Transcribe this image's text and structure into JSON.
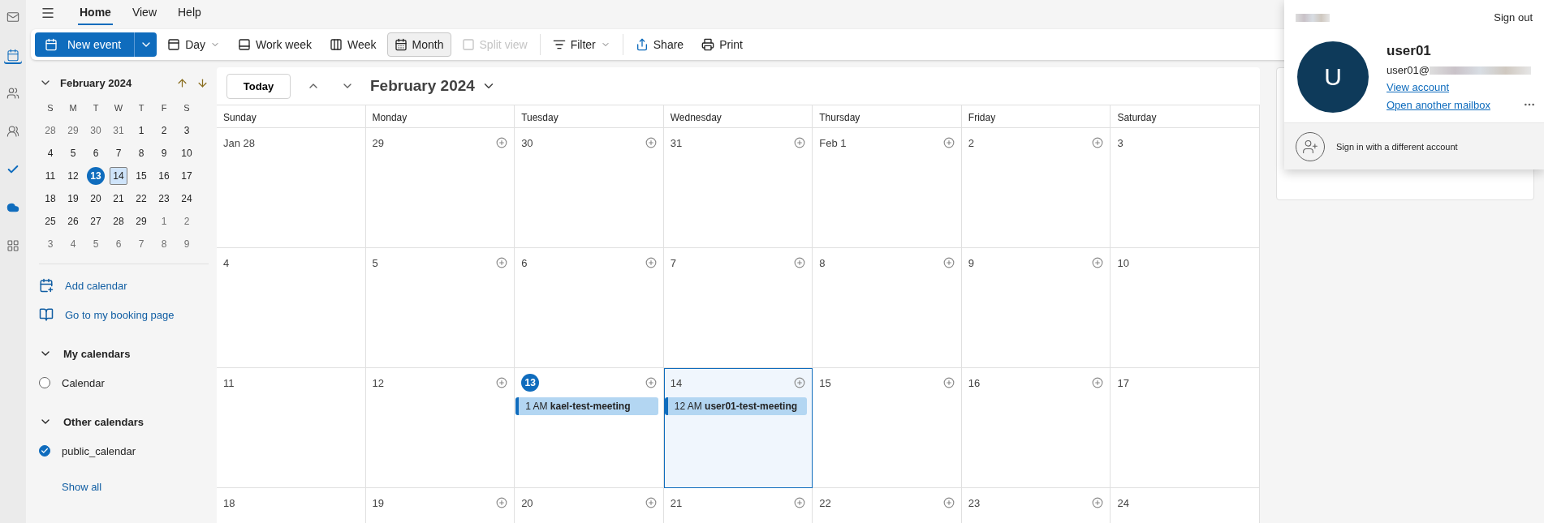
{
  "nav_rail": [
    {
      "kind": "mail",
      "selected": false
    },
    {
      "kind": "calendar",
      "selected": true
    },
    {
      "kind": "people",
      "selected": false
    },
    {
      "kind": "groups",
      "selected": false
    },
    {
      "kind": "todo",
      "selected": false
    },
    {
      "kind": "cloud",
      "selected": false
    },
    {
      "kind": "apps",
      "selected": false
    }
  ],
  "menu_tabs": [
    {
      "label": "Home",
      "selected": true
    },
    {
      "label": "View",
      "selected": false
    },
    {
      "label": "Help",
      "selected": false
    }
  ],
  "ribbon": {
    "new_event": "New event",
    "buttons": [
      {
        "kind": "day",
        "label": "Day",
        "dropdown": true,
        "selected": false,
        "disabled": false
      },
      {
        "kind": "workweek",
        "label": "Work week",
        "dropdown": false,
        "selected": false,
        "disabled": false
      },
      {
        "kind": "week",
        "label": "Week",
        "dropdown": false,
        "selected": false,
        "disabled": false
      },
      {
        "kind": "month",
        "label": "Month",
        "dropdown": false,
        "selected": true,
        "disabled": false
      },
      {
        "kind": "split",
        "label": "Split view",
        "dropdown": false,
        "selected": false,
        "disabled": true
      },
      {
        "kind": "filter",
        "label": "Filter",
        "dropdown": true,
        "selected": false,
        "disabled": false
      },
      {
        "kind": "share",
        "label": "Share",
        "dropdown": false,
        "selected": false,
        "disabled": false
      },
      {
        "kind": "print",
        "label": "Print",
        "dropdown": false,
        "selected": false,
        "disabled": false
      }
    ]
  },
  "mini_calendar": {
    "title": "February 2024",
    "weekdays": [
      "S",
      "M",
      "T",
      "W",
      "T",
      "F",
      "S"
    ],
    "weeks": [
      [
        {
          "day": "28",
          "muted": true,
          "today": false,
          "selected": false
        },
        {
          "day": "29",
          "muted": true,
          "today": false,
          "selected": false
        },
        {
          "day": "30",
          "muted": true,
          "today": false,
          "selected": false
        },
        {
          "day": "31",
          "muted": true,
          "today": false,
          "selected": false
        },
        {
          "day": "1",
          "muted": false,
          "today": false,
          "selected": false
        },
        {
          "day": "2",
          "muted": false,
          "today": false,
          "selected": false
        },
        {
          "day": "3",
          "muted": false,
          "today": false,
          "selected": false
        }
      ],
      [
        {
          "day": "4",
          "muted": false,
          "today": false,
          "selected": false
        },
        {
          "day": "5",
          "muted": false,
          "today": false,
          "selected": false
        },
        {
          "day": "6",
          "muted": false,
          "today": false,
          "selected": false
        },
        {
          "day": "7",
          "muted": false,
          "today": false,
          "selected": false
        },
        {
          "day": "8",
          "muted": false,
          "today": false,
          "selected": false
        },
        {
          "day": "9",
          "muted": false,
          "today": false,
          "selected": false
        },
        {
          "day": "10",
          "muted": false,
          "today": false,
          "selected": false
        }
      ],
      [
        {
          "day": "11",
          "muted": false,
          "today": false,
          "selected": false
        },
        {
          "day": "12",
          "muted": false,
          "today": false,
          "selected": false
        },
        {
          "day": "13",
          "muted": false,
          "today": true,
          "selected": false
        },
        {
          "day": "14",
          "muted": false,
          "today": false,
          "selected": true
        },
        {
          "day": "15",
          "muted": false,
          "today": false,
          "selected": false
        },
        {
          "day": "16",
          "muted": false,
          "today": false,
          "selected": false
        },
        {
          "day": "17",
          "muted": false,
          "today": false,
          "selected": false
        }
      ],
      [
        {
          "day": "18",
          "muted": false,
          "today": false,
          "selected": false
        },
        {
          "day": "19",
          "muted": false,
          "today": false,
          "selected": false
        },
        {
          "day": "20",
          "muted": false,
          "today": false,
          "selected": false
        },
        {
          "day": "21",
          "muted": false,
          "today": false,
          "selected": false
        },
        {
          "day": "22",
          "muted": false,
          "today": false,
          "selected": false
        },
        {
          "day": "23",
          "muted": false,
          "today": false,
          "selected": false
        },
        {
          "day": "24",
          "muted": false,
          "today": false,
          "selected": false
        }
      ],
      [
        {
          "day": "25",
          "muted": false,
          "today": false,
          "selected": false
        },
        {
          "day": "26",
          "muted": false,
          "today": false,
          "selected": false
        },
        {
          "day": "27",
          "muted": false,
          "today": false,
          "selected": false
        },
        {
          "day": "28",
          "muted": false,
          "today": false,
          "selected": false
        },
        {
          "day": "29",
          "muted": false,
          "today": false,
          "selected": false
        },
        {
          "day": "1",
          "muted": true,
          "today": false,
          "selected": false
        },
        {
          "day": "2",
          "muted": true,
          "today": false,
          "selected": false
        }
      ],
      [
        {
          "day": "3",
          "muted": true,
          "today": false,
          "selected": false
        },
        {
          "day": "4",
          "muted": true,
          "today": false,
          "selected": false
        },
        {
          "day": "5",
          "muted": true,
          "today": false,
          "selected": false
        },
        {
          "day": "6",
          "muted": true,
          "today": false,
          "selected": false
        },
        {
          "day": "7",
          "muted": true,
          "today": false,
          "selected": false
        },
        {
          "day": "8",
          "muted": true,
          "today": false,
          "selected": false
        },
        {
          "day": "9",
          "muted": true,
          "today": false,
          "selected": false
        }
      ]
    ]
  },
  "sidebar_links": [
    {
      "kind": "add",
      "label": "Add calendar"
    },
    {
      "kind": "booking",
      "label": "Go to my booking page"
    }
  ],
  "calendar_groups": [
    {
      "title": "My calendars",
      "expanded": true,
      "items": [
        {
          "label": "Calendar",
          "checked": false
        }
      ]
    },
    {
      "title": "Other calendars",
      "expanded": true,
      "items": [
        {
          "label": "public_calendar",
          "checked": true
        }
      ]
    }
  ],
  "show_all": "Show all",
  "calendar": {
    "today_button": "Today",
    "title": "February 2024",
    "weekdays": [
      "Sunday",
      "Monday",
      "Tuesday",
      "Wednesday",
      "Thursday",
      "Friday",
      "Saturday"
    ],
    "weeks": [
      [
        {
          "label": "Jan 28",
          "today": false,
          "selected": false
        },
        {
          "label": "29",
          "today": false,
          "selected": false
        },
        {
          "label": "30",
          "today": false,
          "selected": false
        },
        {
          "label": "31",
          "today": false,
          "selected": false
        },
        {
          "label": "Feb 1",
          "today": false,
          "selected": false
        },
        {
          "label": "2",
          "today": false,
          "selected": false
        },
        {
          "label": "3",
          "today": false,
          "selected": false
        }
      ],
      [
        {
          "label": "4",
          "today": false,
          "selected": false
        },
        {
          "label": "5",
          "today": false,
          "selected": false
        },
        {
          "label": "6",
          "today": false,
          "selected": false
        },
        {
          "label": "7",
          "today": false,
          "selected": false
        },
        {
          "label": "8",
          "today": false,
          "selected": false
        },
        {
          "label": "9",
          "today": false,
          "selected": false
        },
        {
          "label": "10",
          "today": false,
          "selected": false
        }
      ],
      [
        {
          "label": "11",
          "today": false,
          "selected": false
        },
        {
          "label": "12",
          "today": false,
          "selected": false
        },
        {
          "label": "13",
          "today": true,
          "selected": false,
          "events": [
            "1 AM **kael-test-meeting**"
          ]
        },
        {
          "label": "14",
          "today": false,
          "selected": true,
          "events": [
            "12 AM **user01-test-meeting**"
          ]
        },
        {
          "label": "15",
          "today": false,
          "selected": false
        },
        {
          "label": "16",
          "today": false,
          "selected": false
        },
        {
          "label": "17",
          "today": false,
          "selected": false
        }
      ],
      [
        {
          "label": "18",
          "today": false,
          "selected": false
        },
        {
          "label": "19",
          "today": false,
          "selected": false
        },
        {
          "label": "20",
          "today": false,
          "selected": false
        },
        {
          "label": "21",
          "today": false,
          "selected": false
        },
        {
          "label": "22",
          "today": false,
          "selected": false
        },
        {
          "label": "23",
          "today": false,
          "selected": false
        },
        {
          "label": "24",
          "today": false,
          "selected": false
        }
      ]
    ]
  },
  "account_popup": {
    "sign_out": "Sign out",
    "initial": "U",
    "name": "user01",
    "email": "user01@",
    "links": [
      "View account",
      "Open another mailbox"
    ],
    "add_account": "Sign in with a different account"
  }
}
